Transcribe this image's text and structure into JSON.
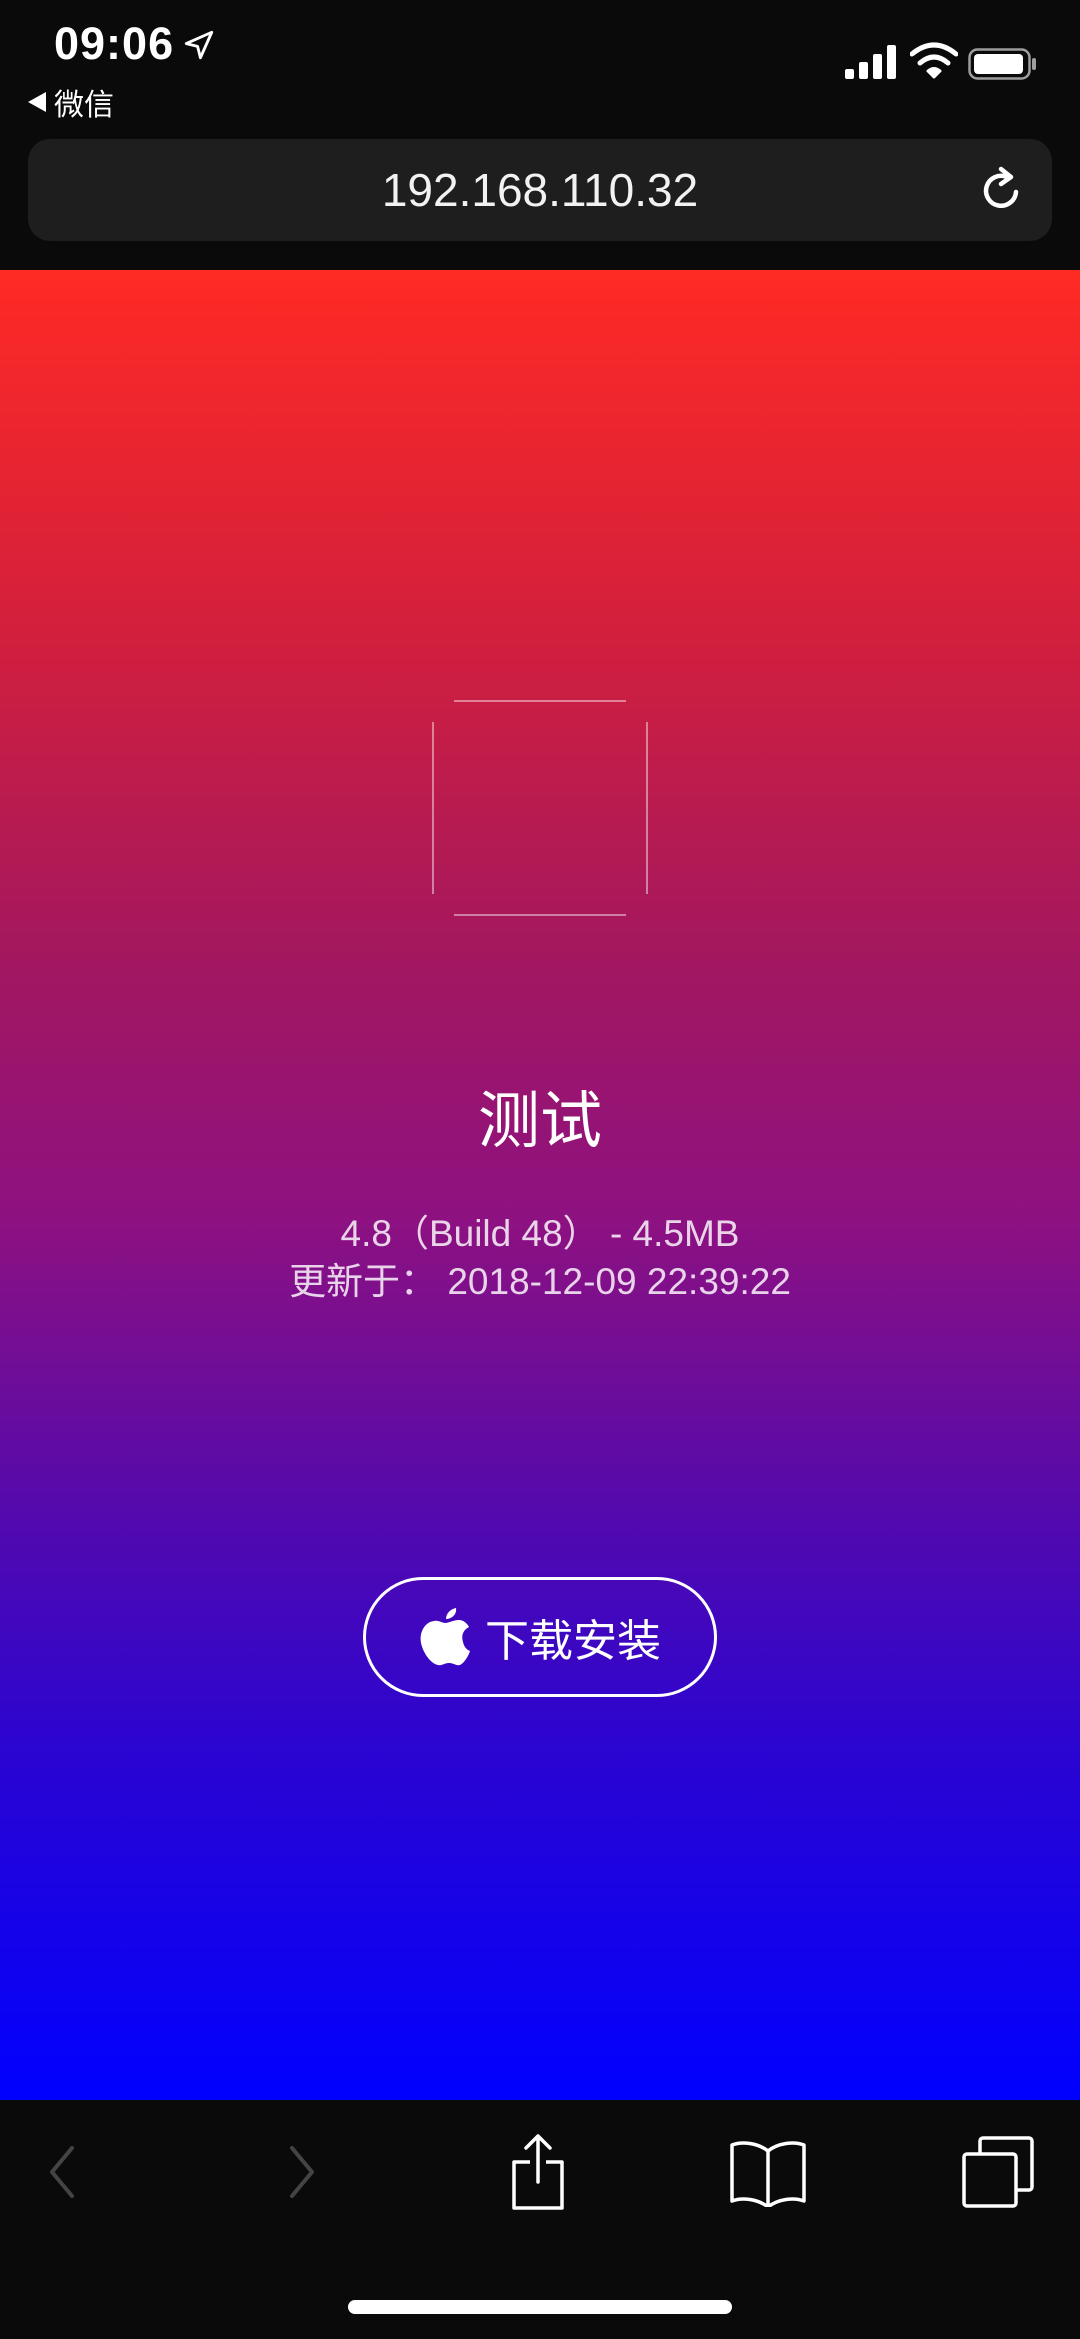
{
  "status_bar": {
    "time": "09:06",
    "back_app": "微信"
  },
  "url_bar": {
    "url": "192.168.110.32"
  },
  "app": {
    "name": "测试",
    "version_line": "4.8（Build 48） - 4.5MB",
    "updated_line": "更新于： 2018-12-09 22:39:22",
    "install_label": "下载安装"
  },
  "toolbar": {
    "icons": [
      "back-icon",
      "forward-icon",
      "share-icon",
      "bookmarks-icon",
      "tabs-icon"
    ]
  },
  "colors": {
    "gradient_top": "#ff2a24",
    "gradient_bottom": "#0000ff",
    "chrome_background": "#0a0a0a"
  }
}
